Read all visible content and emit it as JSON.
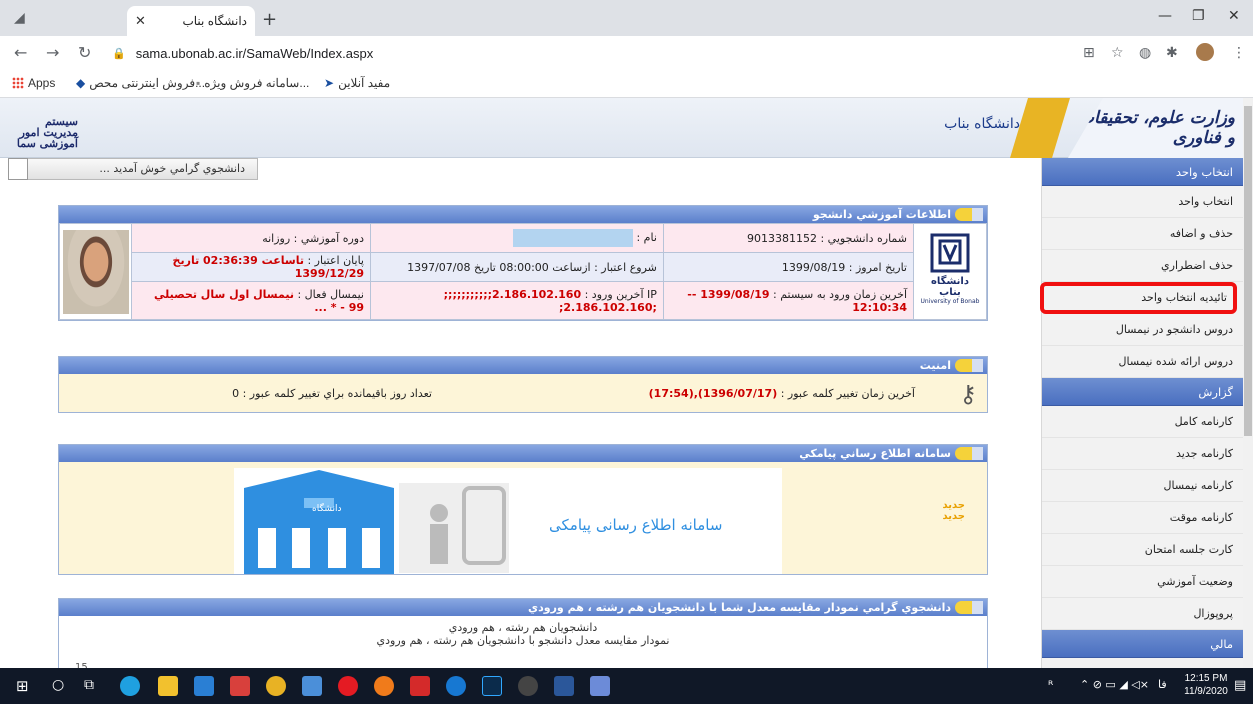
{
  "browser": {
    "tab_title": "دانشگاه بناب",
    "url": "sama.ubonab.ac.ir/SamaWeb/Index.aspx",
    "bookmarks": [
      "Apps",
      "فروش اینترنتی محص...",
      "سامانه فروش ویژه...",
      "مفید آنلاین"
    ]
  },
  "banner": {
    "system_name": "سیستم مدیریت امور آموزشی سما",
    "university": "دانشگاه بناب",
    "ministry": "وزارت علوم، تحقیقات و فناوری"
  },
  "welcome": "دانشجوي گرامي خوش آمديد ...",
  "sidebar": {
    "sections": [
      {
        "title": "انتخاب واحد",
        "items": [
          "انتخاب واحد",
          "حذف و اضافه",
          "حذف اضطراري",
          "تائيديه انتخاب واحد",
          "دروس دانشجو در نيمسال",
          "دروس ارائه شده نيمسال"
        ]
      },
      {
        "title": "گزارش",
        "items": [
          "کارنامه کامل",
          "کارنامه جديد",
          "کارنامه نيمسال",
          "کارنامه موقت",
          "کارت جلسه امتحان",
          "وضعيت آموزشي",
          "پروپوزال"
        ]
      },
      {
        "title": "مالي",
        "items": []
      }
    ]
  },
  "student_info": {
    "title": "اطلاعات آموزشي دانشجو",
    "logo_caption": "دانشگاه بناب",
    "logo_caption_en": "University of Bonab",
    "student_no_label": "شماره دانشجويي :",
    "student_no": "9013381152",
    "name_label": "نام :",
    "course_label": "دوره آموزشي :",
    "course": "روزانه",
    "today_label": "تاريخ امروز :",
    "today": "1399/08/19",
    "validity_start_label": "شروع اعتبار :",
    "validity_start": "ازساعت 08:00:00 تاريخ 1397/07/08",
    "validity_end_label": "پايان اعتبار :",
    "validity_end": "تاساعت 02:36:39 تاريخ 1399/12/29",
    "last_login_label": "آخرين زمان ورود به سيستم :",
    "last_login": "1399/08/19 -- 12:10:34",
    "last_ip_label": "IP آخرين ورود :",
    "last_ip": "2.186.102.160;;;;;;;;;;; ;2.186.102.160;",
    "active_term_label": "نيمسال فعال :",
    "active_term": "نيمسال اول سال تحصيلي 99 - * ..."
  },
  "security": {
    "title": "امنيت",
    "pw_change_label": "آخرين زمان تغيير کلمه عبور :",
    "pw_change_value": "(1396/07/17),(17:54)",
    "days_left_label": "تعداد روز باقيمانده براي تغيير کلمه عبور :",
    "days_left": "0"
  },
  "sms": {
    "title": "سامانه اطلاع رساني پيامکي",
    "new_badge": "جديد",
    "image_text": "سامانه اطلاع رسانی پیامکی",
    "building_label": "دانشگاه"
  },
  "chart_panel": {
    "title": "دانشجوي گرامي نمودار مقايسه معدل شما با دانشجويان هم رشته ، هم ورودي",
    "chart_title": "دانشجويان هم رشته ، هم ورودي",
    "chart_subtitle": "نمودار مقايسه معدل دانشجو با دانشجويان هم رشته ، هم ورودي",
    "y_tick": "15"
  },
  "taskbar": {
    "time": "12:15 PM",
    "date": "11/9/2020",
    "lang": "فا"
  },
  "colors": {
    "accent_blue": "#5b7fcb",
    "highlight_red": "#f01010",
    "value_red": "#c00000"
  }
}
